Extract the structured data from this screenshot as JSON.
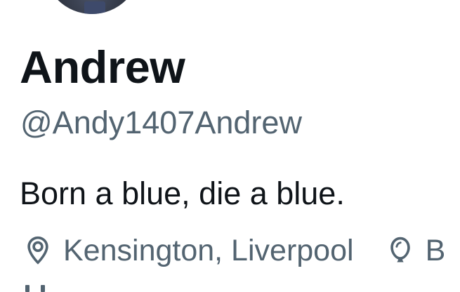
{
  "profile": {
    "display_name": "Andrew",
    "handle": "@Andy1407Andrew",
    "bio": "Born a blue, die a blue.",
    "location": "Kensington, Liverpool",
    "birthday_partial": "B"
  },
  "icons": {
    "location": "location-pin-icon",
    "birthday": "balloon-icon",
    "joined": "calendar-icon"
  },
  "colors": {
    "primary_text": "#0f1419",
    "secondary_text": "#536471",
    "background": "#ffffff"
  }
}
